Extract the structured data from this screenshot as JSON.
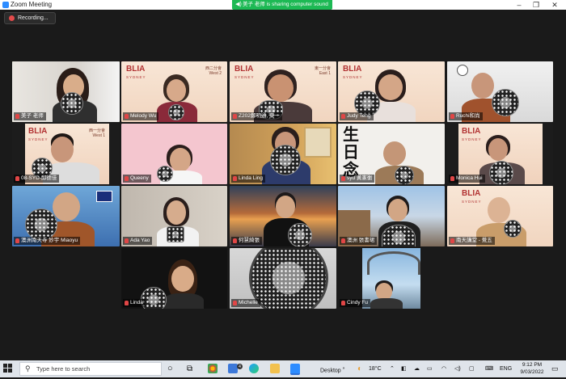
{
  "window": {
    "title": "Zoom Meeting",
    "controls": [
      "–",
      "❐",
      "✕"
    ]
  },
  "share_banner": {
    "text": "美子 老师 is sharing computer sound"
  },
  "recording": {
    "label": "Recording..."
  },
  "colors": {
    "active_speaker": "#b8e030",
    "mute": "#e04646",
    "share": "#1db954"
  },
  "blia": {
    "name": "BLIA",
    "sub": "SYDNEY"
  },
  "participants": [
    {
      "name": "美子 老师",
      "active": true
    },
    {
      "name": "Melody Wu",
      "group": "西二分會",
      "group_en": "West 2"
    },
    {
      "name": "Z202鄭明通, 東一",
      "group": "東一分會",
      "group_en": "East 1"
    },
    {
      "name": "Judy Teng"
    },
    {
      "name": "Ruchi和尚"
    },
    {
      "name": "08-SYD-邱德佳",
      "group": "西一分會",
      "group_en": "West 1"
    },
    {
      "name": "Queeny"
    },
    {
      "name": "Linda Ling"
    },
    {
      "name": "syd 黃憲衡",
      "calligraphy": "生日念"
    },
    {
      "name": "Monica Hui"
    },
    {
      "name": "澳洲南天寺 妙宇 Miaoyu"
    },
    {
      "name": "Ada Yao"
    },
    {
      "name": "何慧綺張"
    },
    {
      "name": "澳洲 張書珺"
    },
    {
      "name": "南天講堂 - 覺五"
    },
    {
      "name": "Linda"
    },
    {
      "name": "Michelle"
    },
    {
      "name": "Cindy Fu"
    }
  ],
  "taskbar": {
    "search_placeholder": "Type here to search",
    "desktop_label": "Desktop",
    "desktop_sup": "»",
    "weather": "18°C",
    "language": "ENG",
    "time": "9:12 PM",
    "date": "9/03/2022",
    "mail_badge": "4"
  }
}
